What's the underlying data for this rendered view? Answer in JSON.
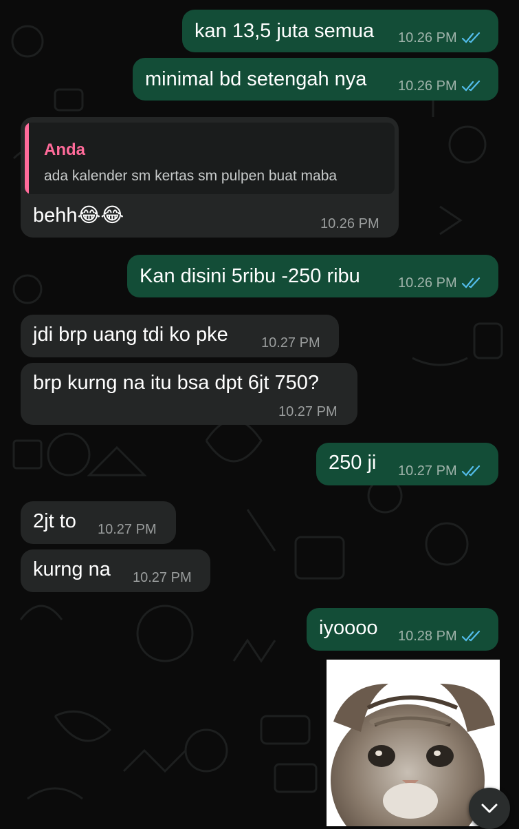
{
  "messages": [
    {
      "dir": "out",
      "text": "kan 13,5 juta semua",
      "time": "10.26 PM",
      "read": true
    },
    {
      "dir": "out",
      "text": "minimal bd setengah nya",
      "time": "10.26 PM",
      "read": true
    },
    {
      "dir": "in",
      "text": "behh😂😂",
      "time": "10.26 PM",
      "quote": {
        "author": "Anda",
        "text": "ada kalender sm kertas sm pulpen buat maba"
      }
    },
    {
      "dir": "out",
      "text": "Kan disini 5ribu -250 ribu",
      "time": "10.26 PM",
      "read": true
    },
    {
      "dir": "in",
      "text": "jdi brp uang tdi ko pke",
      "time": "10.27 PM"
    },
    {
      "dir": "in",
      "text": "brp kurng na itu bsa dpt 6jt 750?",
      "time": "10.27 PM"
    },
    {
      "dir": "out",
      "text": "250 ji",
      "time": "10.27 PM",
      "read": true
    },
    {
      "dir": "in",
      "text": "2jt to",
      "time": "10.27 PM"
    },
    {
      "dir": "in",
      "text": "kurng na",
      "time": "10.27 PM"
    },
    {
      "dir": "out",
      "text": "iyoooo",
      "time": "10.28 PM",
      "read": true
    }
  ],
  "sticker": {
    "subject": "sad kitten sticker"
  },
  "icons": {
    "read": "double-check-icon",
    "scroll": "chevron-down-icon"
  },
  "colors": {
    "outgoing_bubble": "#134d37",
    "incoming_bubble": "#242626",
    "quote_accent": "#ff6b9a",
    "read_ticks": "#53bdeb"
  }
}
